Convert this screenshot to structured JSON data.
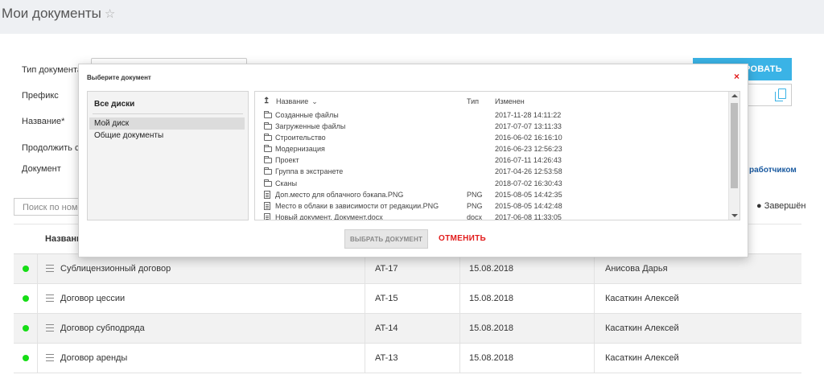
{
  "page": {
    "title": "Мои документы",
    "star": "☆"
  },
  "form": {
    "doc_type_label": "Тип документа",
    "prefix_label": "Префикс",
    "name_label": "Название*",
    "continue_label": "Продолжить с",
    "document_label": "Документ",
    "submit_partial": "ИРОВАТЬ",
    "dev_link_partial": "работчиком"
  },
  "filters": {
    "search_placeholder": "Поиск по номе",
    "completed": "● Завершён"
  },
  "table": {
    "header_name": "Названи",
    "rows": [
      {
        "title": "Сублицензионный договор",
        "number": "AT-17",
        "date": "15.08.2018",
        "author": "Анисова Дарья"
      },
      {
        "title": "Договор цессии",
        "number": "AT-15",
        "date": "15.08.2018",
        "author": "Касаткин Алексей"
      },
      {
        "title": "Договор субподряда",
        "number": "AT-14",
        "date": "15.08.2018",
        "author": "Касаткин Алексей"
      },
      {
        "title": "Договор аренды",
        "number": "AT-13",
        "date": "15.08.2018",
        "author": "Касаткин Алексей"
      }
    ]
  },
  "modal": {
    "title": "Выберите документ",
    "close": "×",
    "drives": {
      "header": "Все диски",
      "items": [
        "Мой диск",
        "Общие документы"
      ]
    },
    "files": {
      "col_name": "Название",
      "col_type": "Тип",
      "col_modified": "Изменен",
      "sort_icon": "↥",
      "chevron": "⌄",
      "rows": [
        {
          "kind": "folder",
          "name": "Созданные файлы",
          "type": "",
          "modified": "2017-11-28 14:11:22"
        },
        {
          "kind": "folder",
          "name": "Загруженные файлы",
          "type": "",
          "modified": "2017-07-07 13:11:33"
        },
        {
          "kind": "folder",
          "name": "Строительство",
          "type": "",
          "modified": "2016-06-02 16:16:10"
        },
        {
          "kind": "folder",
          "name": "Модернизация",
          "type": "",
          "modified": "2016-06-23 12:56:23"
        },
        {
          "kind": "folder",
          "name": "Проект",
          "type": "",
          "modified": "2016-07-11 14:26:43"
        },
        {
          "kind": "folder",
          "name": "Группа в экстранете",
          "type": "",
          "modified": "2017-04-26 12:53:58"
        },
        {
          "kind": "folder",
          "name": "Сканы",
          "type": "",
          "modified": "2018-07-02 16:30:43"
        },
        {
          "kind": "file",
          "name": "Доп.место для облачного бэкапа.PNG",
          "type": "PNG",
          "modified": "2015-08-05 14:42:35"
        },
        {
          "kind": "file",
          "name": "Место в облаки в зависимости от редакции.PNG",
          "type": "PNG",
          "modified": "2015-08-05 14:42:48"
        },
        {
          "kind": "file",
          "name": "Новый документ. Документ.docx",
          "type": "docx",
          "modified": "2017-06-08 11:33:05"
        }
      ]
    },
    "select_button": "ВЫБРАТЬ ДОКУМЕНТ",
    "cancel_button": "ОТМЕНИТЬ"
  },
  "colors": {
    "accent_blue": "#3ab3e6",
    "danger_red": "#e21b1b",
    "status_green": "#16dd16"
  }
}
